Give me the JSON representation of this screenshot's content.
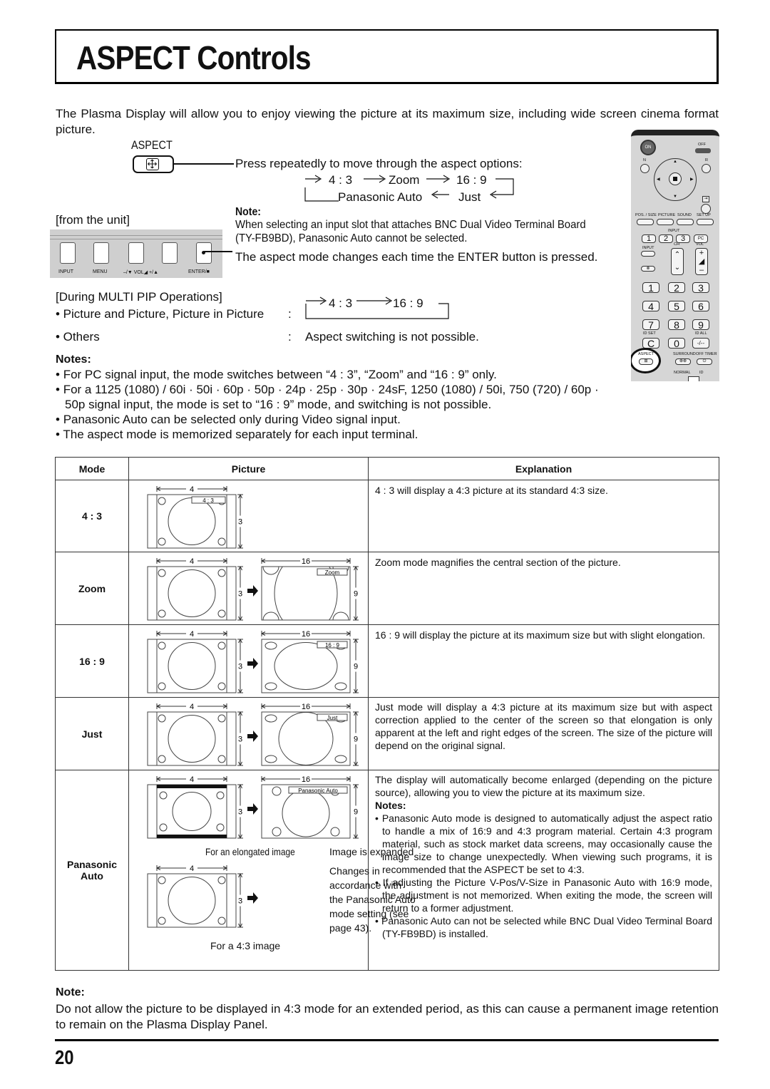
{
  "page": {
    "title": "ASPECT Controls",
    "page_number": "20",
    "intro": "The Plasma Display will allow you to enjoy viewing the picture at its maximum size, including wide screen cinema format picture."
  },
  "aspect_button": {
    "label": "ASPECT",
    "instruction": "Press repeatedly to move through the aspect options:",
    "cycle": [
      "4 : 3",
      "Zoom",
      "16 : 9",
      "Just",
      "Panasonic Auto"
    ]
  },
  "unit": {
    "label": "[from the unit]",
    "buttons": [
      "INPUT",
      "MENU",
      "–/▼ VOL◢ +/▲",
      "ENTER/■"
    ],
    "note_heading": "Note:",
    "note_text": "When selecting an input slot that attaches BNC Dual Video Terminal Board (TY-FB9BD), Panasonic Auto cannot be selected.",
    "enter_text": "The aspect mode changes each time the ENTER button is pressed."
  },
  "multi_pip": {
    "heading": "[During MULTI PIP Operations]",
    "items": [
      {
        "label": "• Picture and Picture, Picture in Picture",
        "sep": ":",
        "cycle": [
          "4 : 3",
          "16 : 9"
        ]
      },
      {
        "label": "• Others",
        "sep": ":",
        "value": "Aspect switching is not possible."
      }
    ]
  },
  "notes": {
    "heading": "Notes:",
    "items": [
      "For PC signal input, the mode switches between “4 : 3”, “Zoom” and “16 : 9” only.",
      "For a 1125 (1080) / 60i · 50i · 60p · 50p · 24p · 25p · 30p · 24sF, 1250 (1080) / 50i, 750 (720) / 60p · 50p signal input, the mode is set to “16 : 9” mode, and switching is not possible.",
      "Panasonic Auto can be selected only during Video signal input.",
      "The aspect mode is memorized separately for each input terminal."
    ]
  },
  "remote": {
    "on": "ON",
    "off": "OFF",
    "n": "N",
    "r": "R",
    "row1": [
      "POS. / SIZE",
      "PICTURE",
      "SOUND",
      "SET UP"
    ],
    "input_label": "INPUT",
    "inputs": [
      "1",
      "2",
      "3",
      "PC"
    ],
    "ch": "CH",
    "vol": "VOL",
    "digits": [
      "1",
      "2",
      "3",
      "4",
      "5",
      "6",
      "7",
      "8",
      "9",
      "C",
      "0",
      "-/--"
    ],
    "id_set": "ID SET",
    "id_all": "ID ALL",
    "aspect": "ASPECT",
    "surround": "SURROUND",
    "off_timer": "OFF TIMER",
    "normal": "NORMAL",
    "id": "ID"
  },
  "table": {
    "headers": [
      "Mode",
      "Picture",
      "Explanation"
    ],
    "dim_labels": {
      "w43": "4",
      "h43": "3",
      "w169": "16",
      "h169": "9"
    },
    "rows": [
      {
        "mode": "4 : 3",
        "tag": "4 : 3",
        "explanation": "4 : 3 will display a 4:3 picture at its standard 4:3 size."
      },
      {
        "mode": "Zoom",
        "tag": "Zoom",
        "explanation": "Zoom mode magnifies the central section of the picture."
      },
      {
        "mode": "16 : 9",
        "tag": "16 : 9",
        "explanation": "16 : 9 will display the picture at its maximum size but with slight elongation."
      },
      {
        "mode": "Just",
        "tag": "Just",
        "explanation": "Just mode will display a 4:3 picture at its maximum size but with aspect correction applied to the center of the screen so that elongation is only apparent at the left and right edges of the screen. The size of the picture will depend on the original signal."
      },
      {
        "mode_line1": "Panasonic",
        "mode_line2": "Auto",
        "tag": "Panasonic Auto",
        "caption_elongated": "For an elongated image",
        "caption_expanded": "Image is expanded",
        "caption_changes": [
          "Changes in",
          "accordance with",
          "the Panasonic Auto",
          "mode setting (see",
          "page 43)."
        ],
        "caption_43": "For a 4:3 image",
        "explanation": "The display will automatically become enlarged (depending on the picture source), allowing you to view the picture at its maximum size.",
        "notes_heading": "Notes:",
        "notes": [
          "Panasonic Auto mode is designed to automatically adjust the aspect ratio to handle a mix of 16:9 and 4:3 program material. Certain 4:3 program material, such as stock market data screens, may occasionally cause the image size to change unexpectedly. When viewing such programs, it is recommended that the ASPECT be set to 4:3.",
          "If adjusting the Picture V-Pos/V-Size in Panasonic Auto with 16:9 mode, the adjustment is not memorized. When exiting the mode, the screen will return to a former adjustment.",
          "Panasonic Auto can not be selected while BNC Dual Video Terminal Board (TY-FB9BD) is installed."
        ]
      }
    ]
  },
  "footer_note": {
    "heading": "Note:",
    "text": "Do not allow the picture to be displayed in 4:3 mode for an extended period, as this can cause a permanent image retention to remain on the Plasma Display Panel."
  }
}
